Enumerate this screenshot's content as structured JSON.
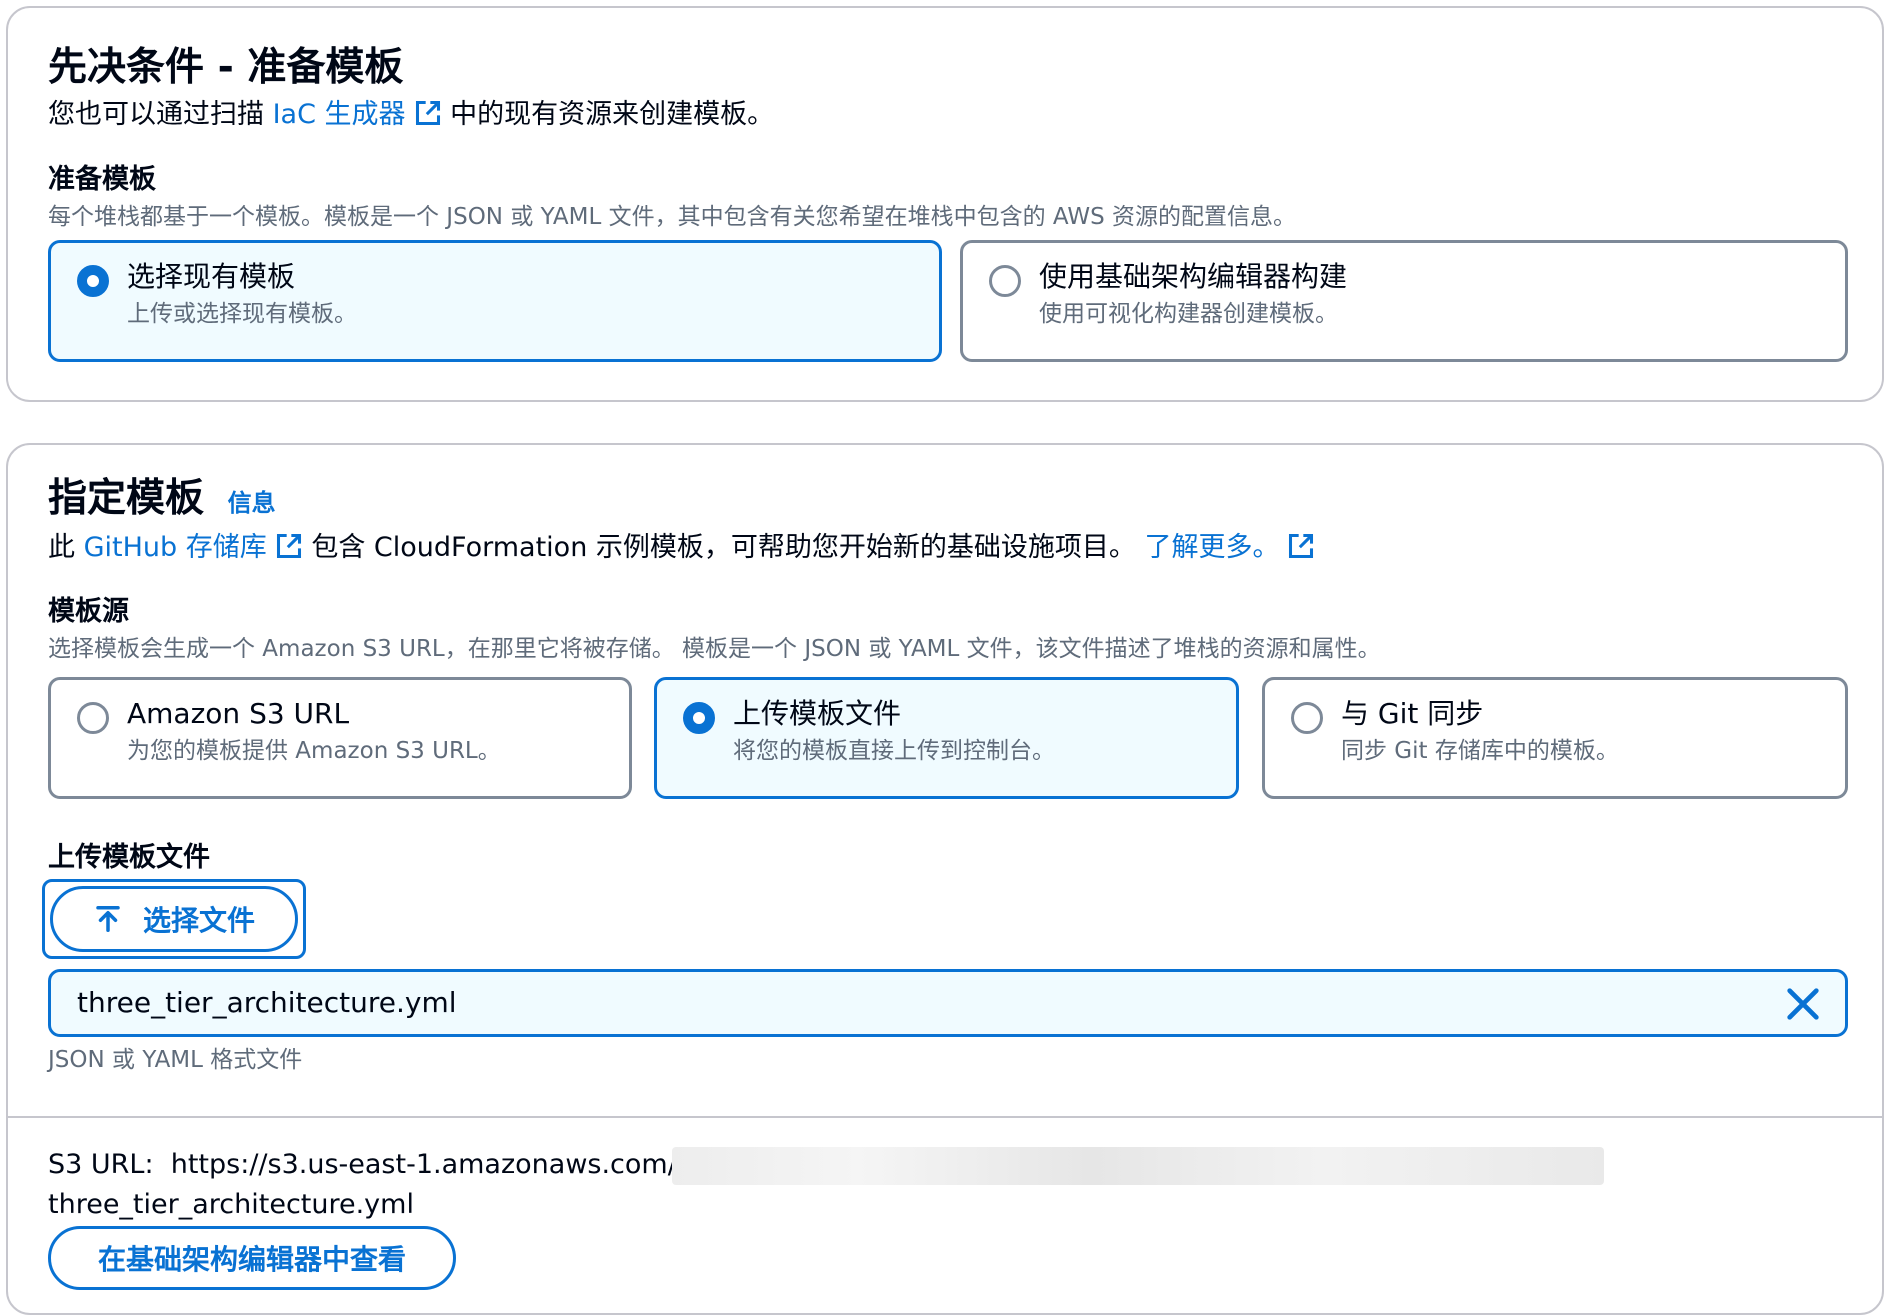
{
  "prereq": {
    "title": "先决条件 - 准备模板",
    "intro_before": "您也可以通过扫描 ",
    "intro_link": "IaC 生成器",
    "intro_after": " 中的现有资源来创建模板。",
    "prepare_label": "准备模板",
    "prepare_desc": "每个堆栈都基于一个模板。模板是一个 JSON 或 YAML 文件，其中包含有关您希望在堆栈中包含的 AWS 资源的配置信息。",
    "options": [
      {
        "title": "选择现有模板",
        "desc": "上传或选择现有模板。",
        "selected": true
      },
      {
        "title": "使用基础架构编辑器构建",
        "desc": "使用可视化构建器创建模板。",
        "selected": false
      }
    ]
  },
  "specify": {
    "title": "指定模板",
    "info_link": "信息",
    "intro_before": "此 ",
    "intro_link": "GitHub 存储库",
    "intro_after": " 包含 CloudFormation 示例模板，可帮助您开始新的基础设施项目。 ",
    "learn_more": "了解更多。",
    "source_label": "模板源",
    "source_desc": "选择模板会生成一个 Amazon S3 URL，在那里它将被存储。 模板是一个 JSON 或 YAML 文件，该文件描述了堆栈的资源和属性。",
    "options": [
      {
        "title": "Amazon S3 URL",
        "desc": "为您的模板提供 Amazon S3 URL。",
        "selected": false
      },
      {
        "title": "上传模板文件",
        "desc": "将您的模板直接上传到控制台。",
        "selected": true
      },
      {
        "title": "与 Git 同步",
        "desc": "同步 Git 存储库中的模板。",
        "selected": false
      }
    ],
    "upload_label": "上传模板文件",
    "choose_file_button": "选择文件",
    "file_name": "three_tier_architecture.yml",
    "file_hint": "JSON 或 YAML 格式文件",
    "s3_url_label": "S3 URL:",
    "s3_url_value": "https://s3.us-east-1.amazonaws.com/",
    "s3_url_file": "three_tier_architecture.yml",
    "view_button": "在基础架构编辑器中查看"
  },
  "colors": {
    "accent": "#0972d3",
    "selected_bg": "#f0fbff",
    "border": "#7d8998",
    "text": "#000716",
    "muted": "#5f6b7a"
  },
  "icons": [
    "external-link-icon",
    "radio-selected-icon",
    "radio-unselected-icon",
    "upload-arrow-icon",
    "close-icon"
  ]
}
